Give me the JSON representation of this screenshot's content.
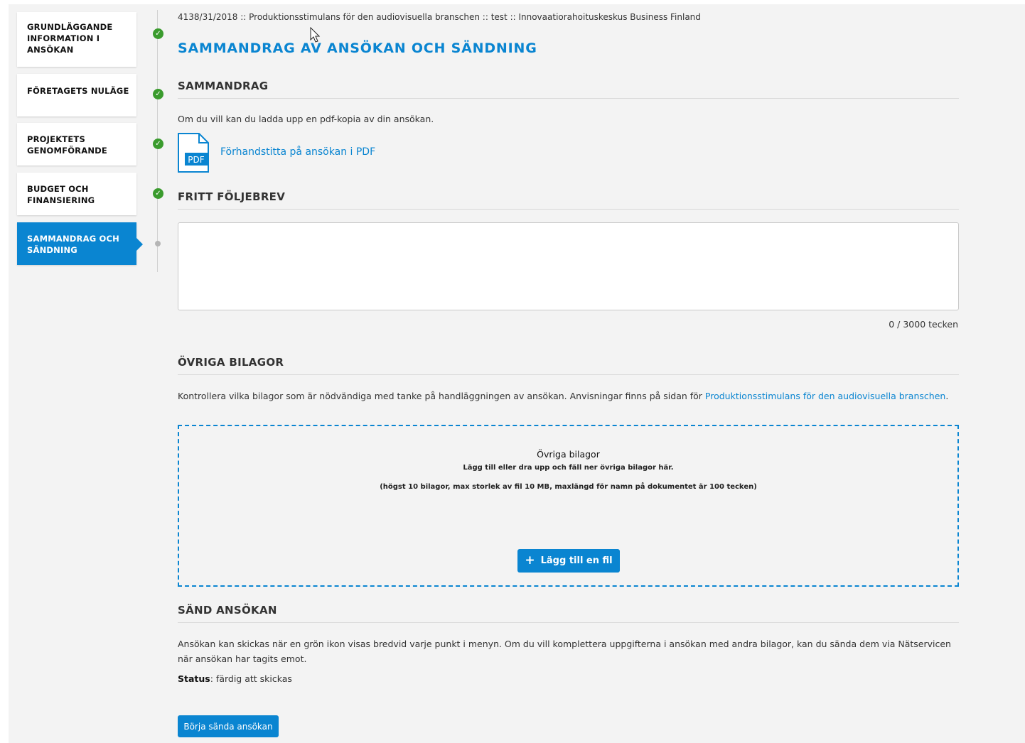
{
  "sidebar": {
    "items": [
      {
        "label": "GRUNDLÄGGANDE INFORMATION I ANSÖKAN",
        "status": "complete"
      },
      {
        "label": "FÖRETAGETS NULÄGE",
        "status": "complete"
      },
      {
        "label": "PROJEKTETS GENOMFÖRANDE",
        "status": "complete"
      },
      {
        "label": "BUDGET OCH FINANSIERING",
        "status": "complete"
      },
      {
        "label": "SAMMANDRAG OCH SÄNDNING",
        "status": "active"
      }
    ],
    "complete_color": "#3a9b2d",
    "active_color": "#0a85d1"
  },
  "header": {
    "breadcrumb": "4138/31/2018 :: Produktionsstimulans för den audiovisuella branschen :: test :: Innovaatiorahoituskeskus Business Finland",
    "title": "SAMMANDRAG AV ANSÖKAN OCH SÄNDNING"
  },
  "summary": {
    "heading": "SAMMANDRAG",
    "description": "Om du vill kan du ladda upp en pdf-kopia av din ansökan.",
    "pdf_icon_label": "PDF",
    "pdf_link": "Förhandstitta på ansökan i PDF"
  },
  "cover_letter": {
    "heading": "FRITT FÖLJEBREV",
    "value": "",
    "counter": "0 / 3000 tecken"
  },
  "attachments": {
    "heading": "ÖVRIGA BILAGOR",
    "instructions_prefix": "Kontrollera vilka bilagor som är nödvändiga med tanke på handläggningen av ansökan. Anvisningar finns på sidan för ",
    "instructions_link": "Produktionsstimulans för den audiovisuella branschen",
    "instructions_suffix": ".",
    "dropzone_title": "Övriga bilagor",
    "dropzone_subtitle": "Lägg till eller dra upp och fäll ner övriga bilagor här.",
    "dropzone_limits": "(högst 10 bilagor, max storlek av fil 10 MB, maxlängd för namn på dokumentet är 100 tecken)",
    "add_file_label": "Lägg till en fil"
  },
  "send": {
    "heading": "SÄND ANSÖKAN",
    "description": "Ansökan kan skickas när en grön ikon visas bredvid varje punkt i menyn. Om du vill komplettera uppgifterna i ansökan med andra bilagor, kan du sända dem via Nätservicen när ansökan har tagits emot.",
    "status_label": "Status",
    "status_value": ": färdig att skickas",
    "button_label": "Börja sända ansökan"
  }
}
